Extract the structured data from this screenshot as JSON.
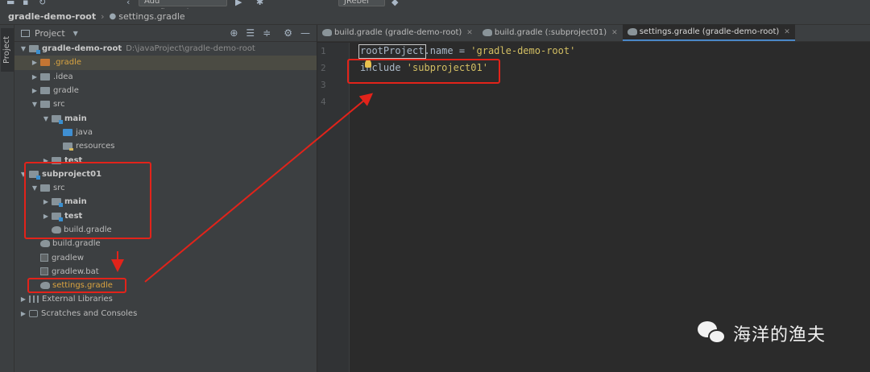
{
  "toolbar": {
    "config_label": "Add Configuration...",
    "runner_label": "JRebel"
  },
  "breadcrumb": {
    "root": "gradle-demo-root",
    "file": "settings.gradle"
  },
  "strip": {
    "label": "Project"
  },
  "panel": {
    "title": "Project"
  },
  "tree": {
    "root": {
      "name": "gradle-demo-root",
      "path": "D:\\javaProject\\gradle-demo-root"
    },
    "gradle_dir": ".gradle",
    "idea_dir": ".idea",
    "gradle": "gradle",
    "src": "src",
    "main": "main",
    "java": "java",
    "resources": "resources",
    "test": "test",
    "subproject": "subproject01",
    "sub_src": "src",
    "sub_main": "main",
    "sub_test": "test",
    "sub_build": "build.gradle",
    "build": "build.gradle",
    "gradlew": "gradlew",
    "gradlew_bat": "gradlew.bat",
    "settings": "settings.gradle",
    "ext_libs": "External Libraries",
    "scratches": "Scratches and Consoles"
  },
  "tabs": [
    {
      "label": "build.gradle (gradle-demo-root)"
    },
    {
      "label": "build.gradle (:subproject01)"
    },
    {
      "label": "settings.gradle (gradle-demo-root)"
    }
  ],
  "editor": {
    "line_numbers": [
      "1",
      "2",
      "3",
      "4"
    ],
    "line1": {
      "ident": "rootProject",
      "rest": ".name = ",
      "string": "'gradle-demo-root'"
    },
    "line2": {
      "keyword": "include ",
      "string": "'subproject01'"
    }
  },
  "watermark": {
    "text": "海洋的渔夫"
  },
  "colors": {
    "annotation": "#e2231a",
    "accent": "#4a88c7",
    "string": "#6a8759"
  }
}
